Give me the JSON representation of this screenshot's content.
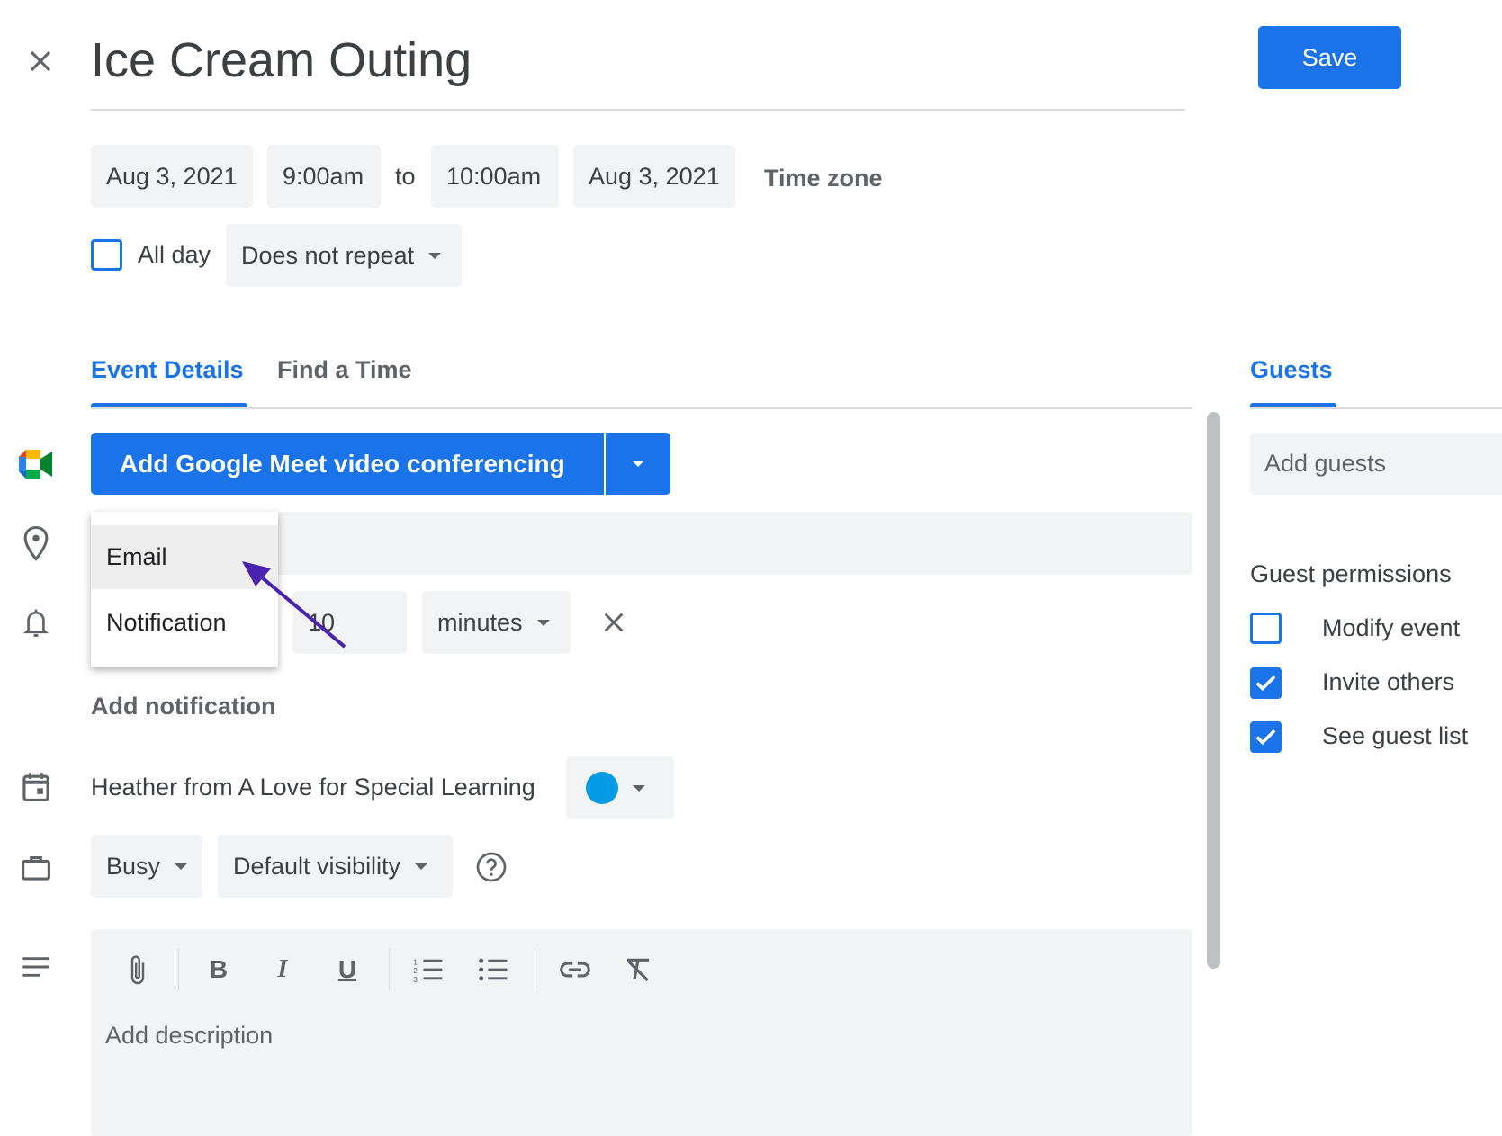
{
  "title": "Ice Cream Outing",
  "save_label": "Save",
  "start_date": "Aug 3, 2021",
  "start_time": "9:00am",
  "to_label": "to",
  "end_time": "10:00am",
  "end_date": "Aug 3, 2021",
  "time_zone_label": "Time zone",
  "all_day_label": "All day",
  "all_day_checked": false,
  "repeat_value": "Does not repeat",
  "tabs": [
    {
      "label": "Event Details",
      "active": true
    },
    {
      "label": "Find a Time",
      "active": false
    }
  ],
  "guests_tab": "Guests",
  "meet_button": "Add Google Meet video conferencing",
  "notification_menu": {
    "items": [
      "Email",
      "Notification"
    ],
    "highlighted": "Email"
  },
  "notification": {
    "value": "10",
    "unit": "minutes"
  },
  "add_notification": "Add notification",
  "calendar_owner": "Heather from A Love for Special Learning",
  "calendar_color": "#039be5",
  "availability": "Busy",
  "visibility": "Default visibility",
  "description_placeholder": "Add description",
  "guests": {
    "placeholder": "Add guests",
    "permissions_title": "Guest permissions",
    "permissions": [
      {
        "label": "Modify event",
        "checked": false
      },
      {
        "label": "Invite others",
        "checked": true
      },
      {
        "label": "See guest list",
        "checked": true
      }
    ]
  },
  "colors": {
    "accent": "#1a73e8",
    "annotation_arrow": "#4a22b0"
  }
}
